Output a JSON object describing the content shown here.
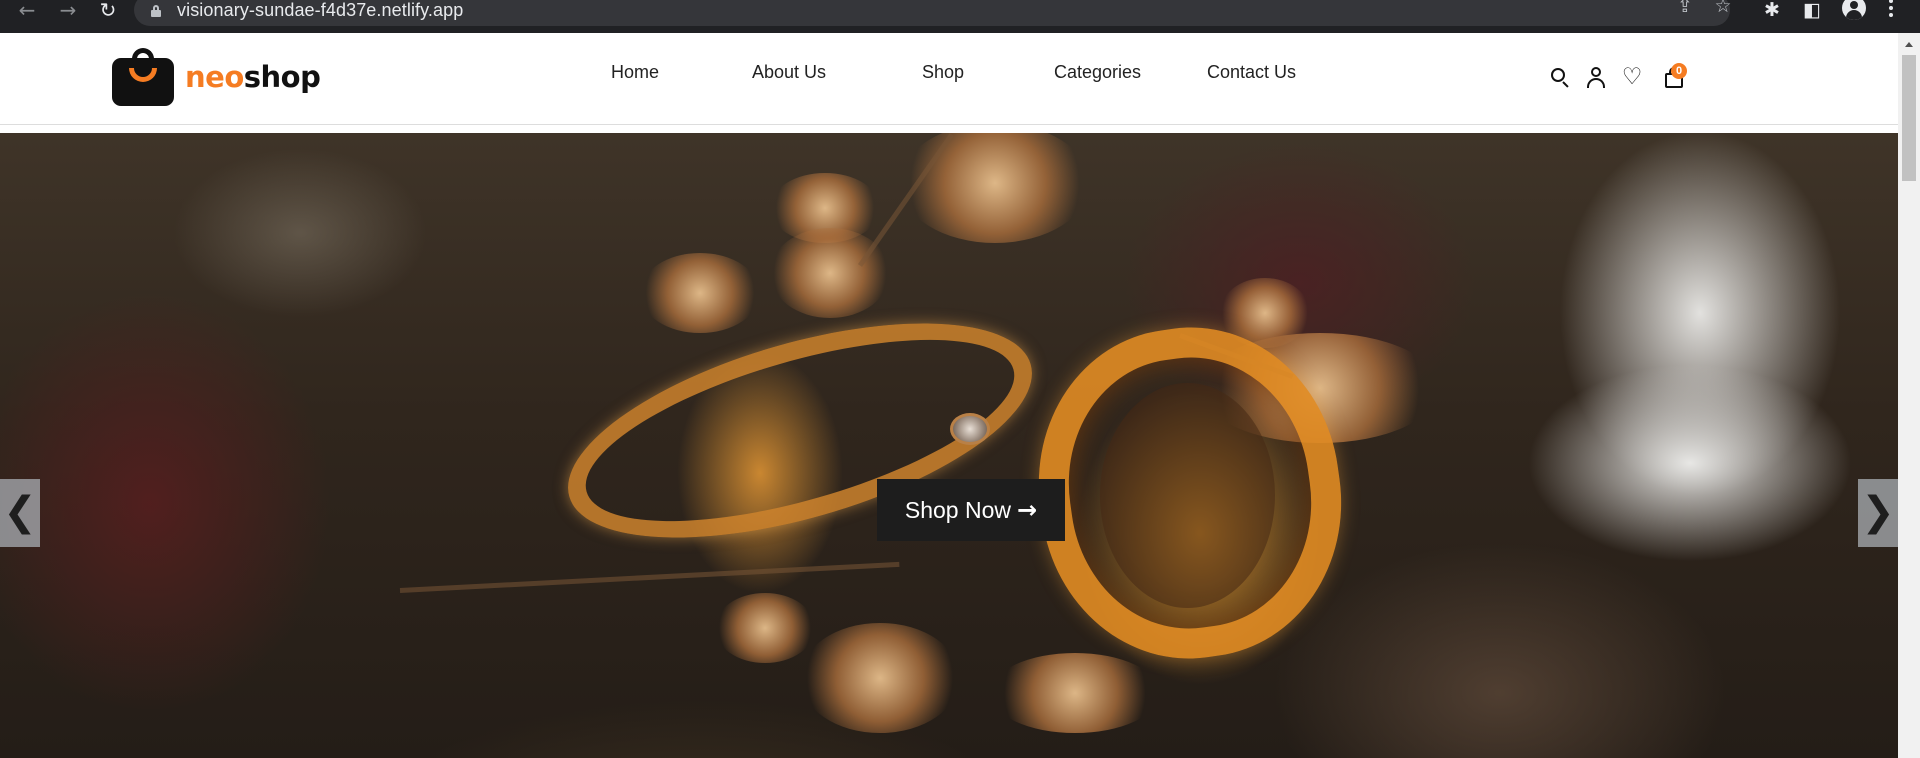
{
  "browser": {
    "url": "visionary-sundae-f4d37e.netlify.app",
    "back_icon": "arrow-back-icon",
    "forward_icon": "arrow-forward-icon",
    "reload_icon": "reload-icon",
    "toolbar_icons": [
      "share-icon",
      "bookmark-star-icon",
      "extensions-puzzle-icon",
      "side-panel-icon",
      "profile-avatar-icon",
      "menu-kebab-icon"
    ]
  },
  "site": {
    "logo": {
      "prefix": "neo",
      "suffix": "shop",
      "accent_color": "#f57c22"
    },
    "nav": [
      "Home",
      "About Us",
      "Shop",
      "Categories",
      "Contact Us"
    ],
    "icons": [
      "search-icon",
      "user-icon",
      "heart-icon",
      "cart-icon"
    ],
    "cart_count": "0"
  },
  "hero": {
    "cta_label": "Shop Now",
    "cta_icon": "arrow-right-icon",
    "prev_label": "❮",
    "next_label": "❯",
    "image_icon": "gold-rings-photo"
  }
}
